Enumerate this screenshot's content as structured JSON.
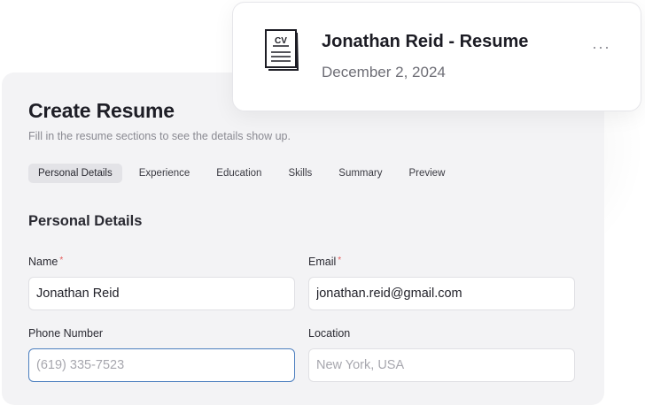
{
  "form": {
    "title": "Create Resume",
    "subtitle": "Fill in the resume sections to see the details show up.",
    "tabs": [
      {
        "label": "Personal Details",
        "active": true
      },
      {
        "label": "Experience",
        "active": false
      },
      {
        "label": "Education",
        "active": false
      },
      {
        "label": "Skills",
        "active": false
      },
      {
        "label": "Summary",
        "active": false
      },
      {
        "label": "Preview",
        "active": false
      }
    ],
    "section_title": "Personal Details",
    "required_marker": "*",
    "fields": {
      "name": {
        "label": "Name",
        "value": "Jonathan Reid",
        "placeholder": "",
        "required": true
      },
      "email": {
        "label": "Email",
        "value": "jonathan.reid@gmail.com",
        "placeholder": "",
        "required": true
      },
      "phone": {
        "label": "Phone Number",
        "value": "",
        "placeholder": "(619) 335-7523",
        "required": false,
        "focused": true
      },
      "location": {
        "label": "Location",
        "value": "",
        "placeholder": "New York, USA",
        "required": false
      }
    }
  },
  "card": {
    "icon": "cv-document-icon",
    "icon_text": "CV",
    "title": "Jonathan Reid - Resume",
    "date": "December 2, 2024",
    "more_label": "···"
  },
  "colors": {
    "panel_bg": "#f3f3f5",
    "required": "#e45a5a",
    "focus_border": "#4d7fbf",
    "active_tab_bg": "#e3e3e7"
  }
}
